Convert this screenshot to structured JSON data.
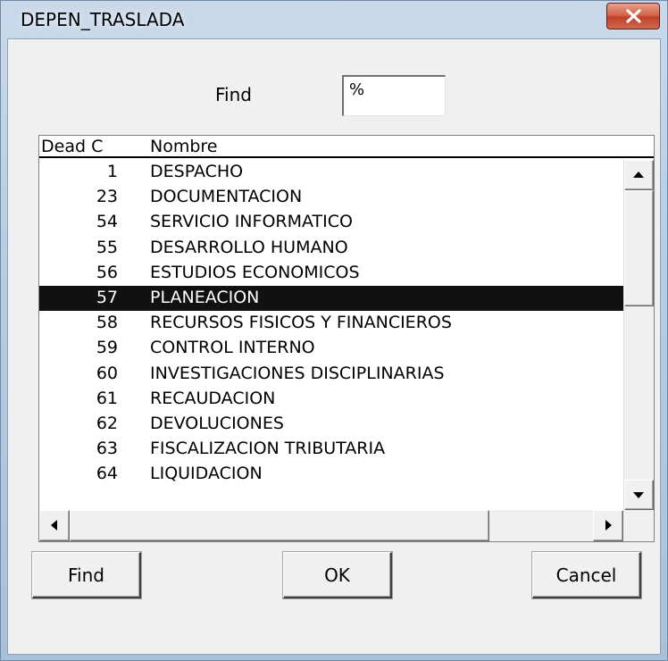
{
  "window": {
    "title": "DEPEN_TRASLADA"
  },
  "search": {
    "label": "Find",
    "value": "%"
  },
  "list": {
    "columns": [
      "Dead C",
      "Nombre"
    ],
    "rows": [
      {
        "code": "1",
        "name": "DESPACHO"
      },
      {
        "code": "23",
        "name": "DOCUMENTACION"
      },
      {
        "code": "54",
        "name": "SERVICIO INFORMATICO"
      },
      {
        "code": "55",
        "name": "DESARROLLO HUMANO"
      },
      {
        "code": "56",
        "name": "ESTUDIOS ECONOMICOS"
      },
      {
        "code": "57",
        "name": "PLANEACION"
      },
      {
        "code": "58",
        "name": "RECURSOS FISICOS Y FINANCIEROS"
      },
      {
        "code": "59",
        "name": "CONTROL INTERNO"
      },
      {
        "code": "60",
        "name": "INVESTIGACIONES DISCIPLINARIAS"
      },
      {
        "code": "61",
        "name": "RECAUDACION"
      },
      {
        "code": "62",
        "name": "DEVOLUCIONES"
      },
      {
        "code": "63",
        "name": "FISCALIZACION TRIBUTARIA"
      },
      {
        "code": "64",
        "name": "LIQUIDACION"
      }
    ],
    "selected_code": "57"
  },
  "buttons": {
    "find": "Find",
    "ok": "OK",
    "cancel": "Cancel"
  },
  "icons": {
    "close": "close-icon",
    "scroll_up": "arrow-up-icon",
    "scroll_down": "arrow-down-icon",
    "scroll_left": "arrow-left-icon",
    "scroll_right": "arrow-right-icon"
  },
  "colors": {
    "selection_background": "#111111",
    "selection_text": "#ffffff",
    "close_button": "#c9523a"
  }
}
